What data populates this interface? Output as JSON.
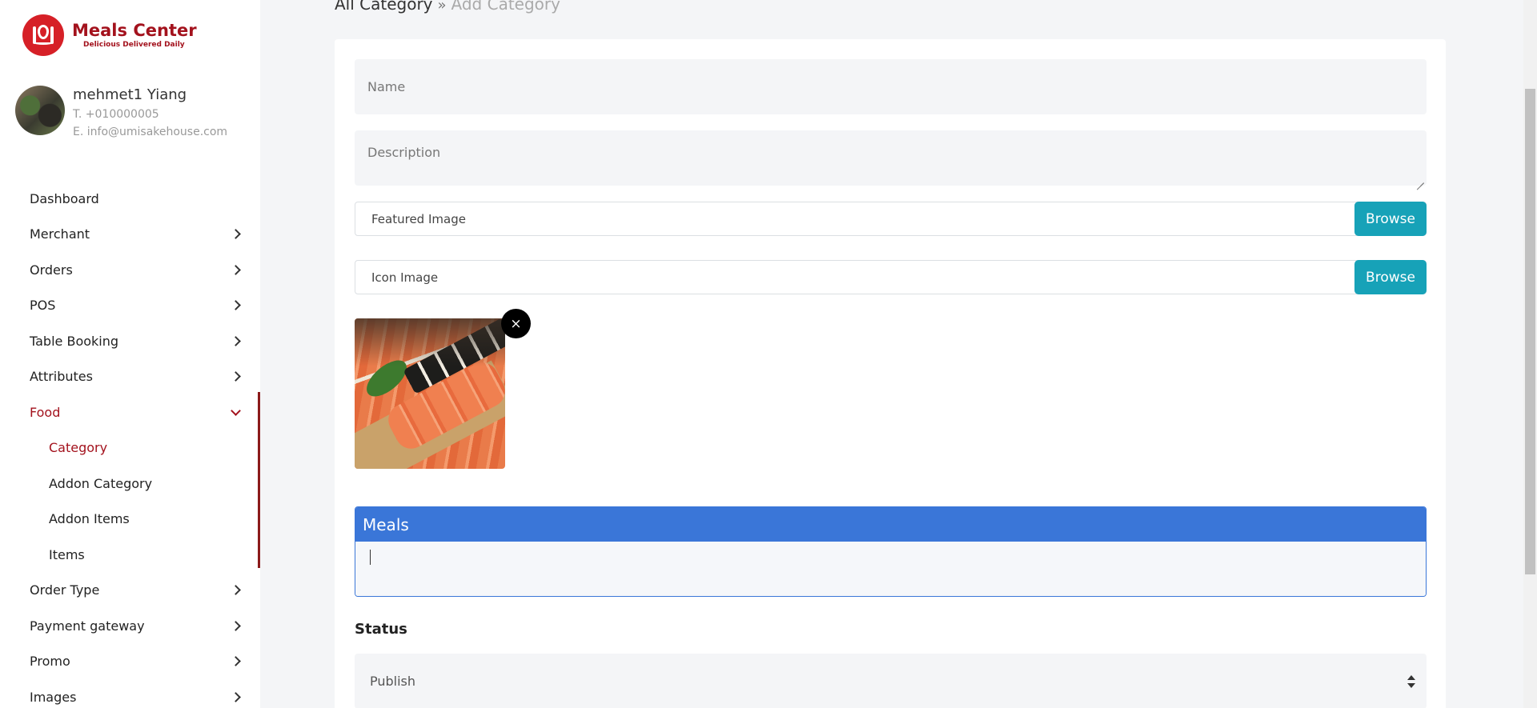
{
  "brand": {
    "title": "Meals Center",
    "tagline": "Delicious Delivered Daily"
  },
  "profile": {
    "name": "mehmet1 Yiang",
    "phone": "T. +010000005",
    "email": "E. info@umisakehouse.com"
  },
  "nav": {
    "dashboard": "Dashboard",
    "merchant": "Merchant",
    "orders": "Orders",
    "pos": "POS",
    "table_booking": "Table Booking",
    "attributes": "Attributes",
    "food": "Food",
    "food_sub": {
      "category": "Category",
      "addon_category": "Addon Category",
      "addon_items": "Addon Items",
      "items": "Items"
    },
    "order_type": "Order Type",
    "payment_gateway": "Payment gateway",
    "promo": "Promo",
    "images": "Images"
  },
  "breadcrumb": {
    "parent": "All Category",
    "separator": "»",
    "current": "Add Category"
  },
  "form": {
    "name_placeholder": "Name",
    "description_placeholder": "Description",
    "featured_image_label": "Featured Image",
    "icon_image_label": "Icon Image",
    "browse_label": "Browse",
    "remove_icon": "×",
    "meals_header": "Meals",
    "status_label": "Status",
    "status_value": "Publish"
  },
  "colors": {
    "brand": "#a3121d",
    "browse": "#17a2b8",
    "meals_header": "#3a76d8"
  }
}
